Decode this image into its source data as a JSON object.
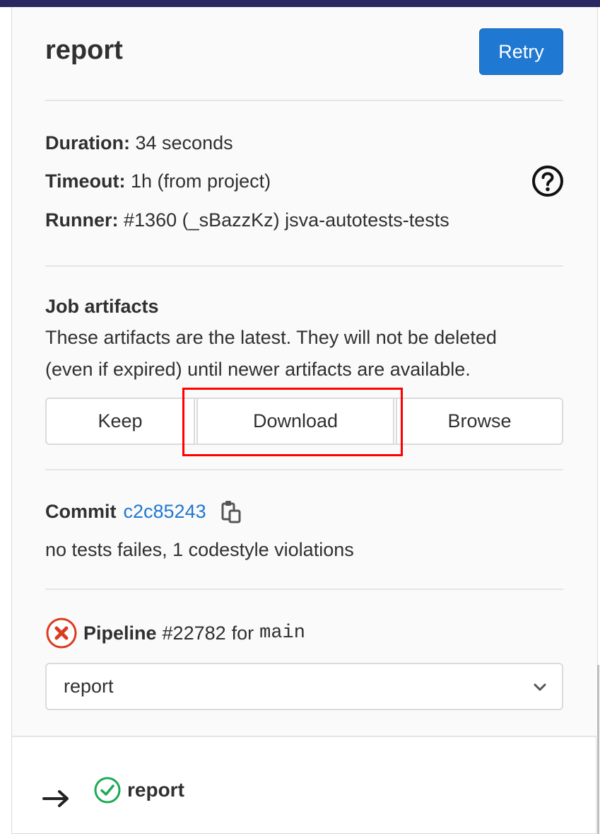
{
  "job": {
    "title": "report",
    "retry_label": "Retry"
  },
  "info": {
    "duration_label": "Duration:",
    "duration_value": "34 seconds",
    "timeout_label": "Timeout:",
    "timeout_value": "1h (from project)",
    "runner_label": "Runner:",
    "runner_value": "#1360 (_sBazzKz) jsva-autotests-tests"
  },
  "artifacts": {
    "title": "Job artifacts",
    "description_line1": "These artifacts are the latest. They will not be deleted",
    "description_line2": "(even if expired) until newer artifacts are available.",
    "keep_label": "Keep",
    "download_label": "Download",
    "browse_label": "Browse"
  },
  "commit": {
    "label": "Commit",
    "sha": "c2c85243",
    "message": "no tests failes, 1 codestyle violations"
  },
  "pipeline": {
    "label": "Pipeline",
    "number": "#22782",
    "for_text": "for",
    "branch": "main",
    "stage_selected": "report"
  },
  "jobs_list": [
    {
      "name": "report",
      "status": "passed"
    }
  ],
  "colors": {
    "accent": "#1f78d1",
    "failed": "#db3b21",
    "success": "#1aaa55",
    "highlight": "#ff0000"
  }
}
